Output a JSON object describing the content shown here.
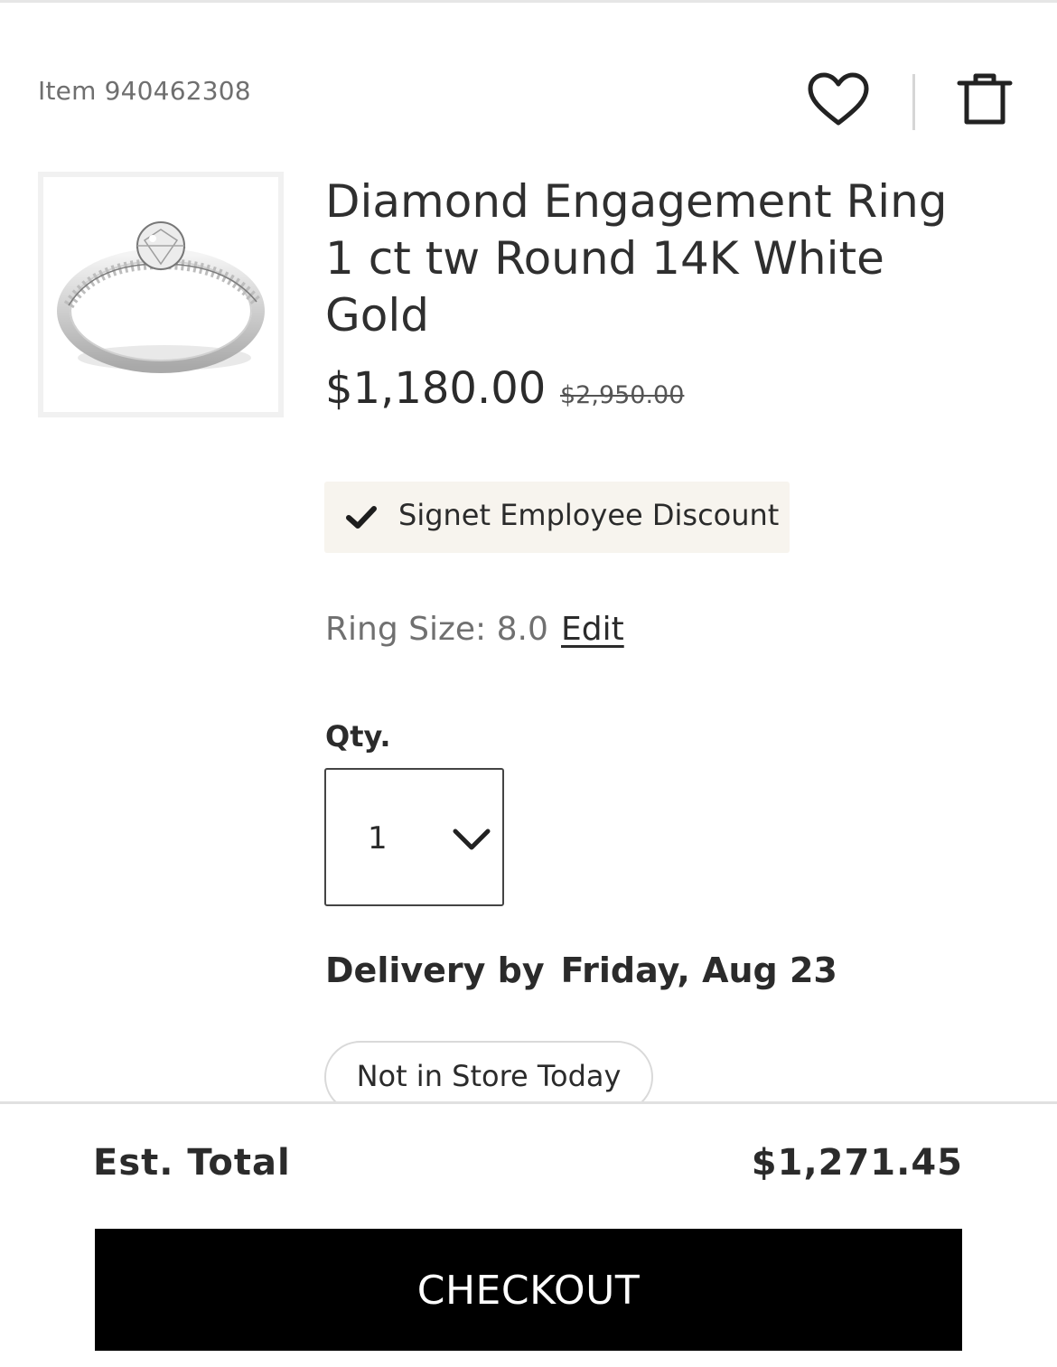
{
  "header": {
    "item_number": "Item 940462308",
    "wishlist_icon": "heart-icon",
    "remove_icon": "trash-icon"
  },
  "product": {
    "title": "Diamond Engagement Ring 1 ct tw Round 14K White Gold",
    "sale_price": "$1,180.00",
    "original_price": "$2,950.00",
    "image_icon": "ring-image"
  },
  "discount": {
    "label": "Signet Employee Discount",
    "icon": "checkmark-icon"
  },
  "ring_size": {
    "label": "Ring Size: 8.0",
    "edit_label": "Edit"
  },
  "quantity": {
    "label": "Qty.",
    "selected": "1"
  },
  "delivery": {
    "label": "Delivery by",
    "date": "Friday, Aug 23"
  },
  "store": {
    "availability": "Not in Store Today"
  },
  "summary": {
    "est_total_label": "Est. Total",
    "est_total_value": "$1,271.45",
    "checkout_label": "CHECKOUT"
  },
  "colors": {
    "badge_bg": "#f7f4ee",
    "checkout_bg": "#000000",
    "text": "#2b2b2b"
  }
}
